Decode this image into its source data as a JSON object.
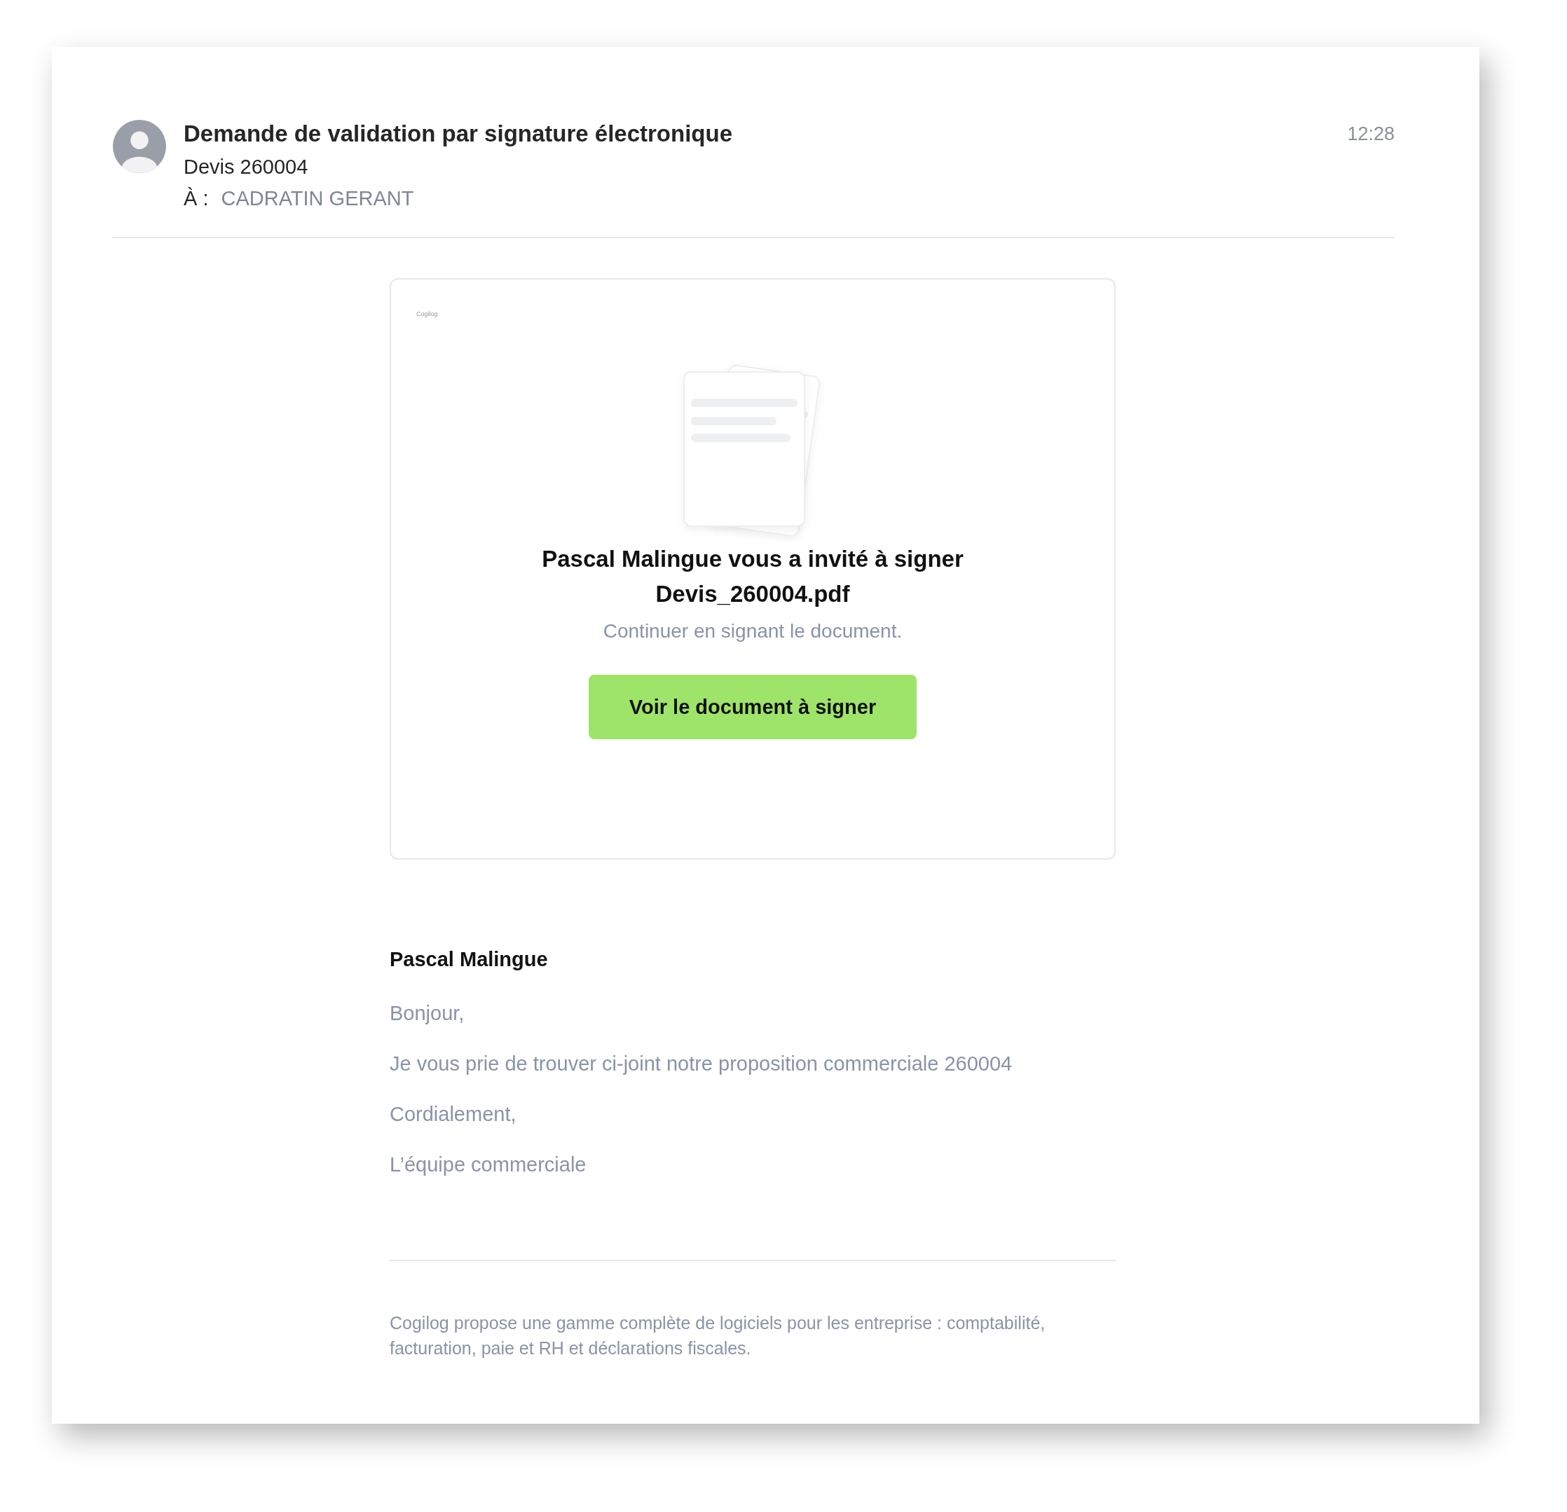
{
  "header": {
    "subject": "Demande de validation par signature électronique",
    "time": "12:28",
    "summary": "Devis 260004",
    "to_label": "À :",
    "to_value": "CADRATIN GERANT"
  },
  "card": {
    "logo": "Cogilog",
    "heading_line_1": "Pascal Malingue vous a invité à signer",
    "heading_line_2": "Devis_260004.pdf",
    "subtitle": "Continuer en signant le document.",
    "button": "Voir le document à signer"
  },
  "message": {
    "sender": "Pascal Malingue",
    "paragraphs": [
      "Bonjour,",
      "Je vous prie de trouver ci-joint notre proposition commerciale 260004",
      "Cordialement,",
      "L’équipe commerciale"
    ]
  },
  "footer": "Cogilog propose une gamme complète de logiciels pour les entreprise : comptabilité, facturation, paie et RH et déclarations fiscales."
}
